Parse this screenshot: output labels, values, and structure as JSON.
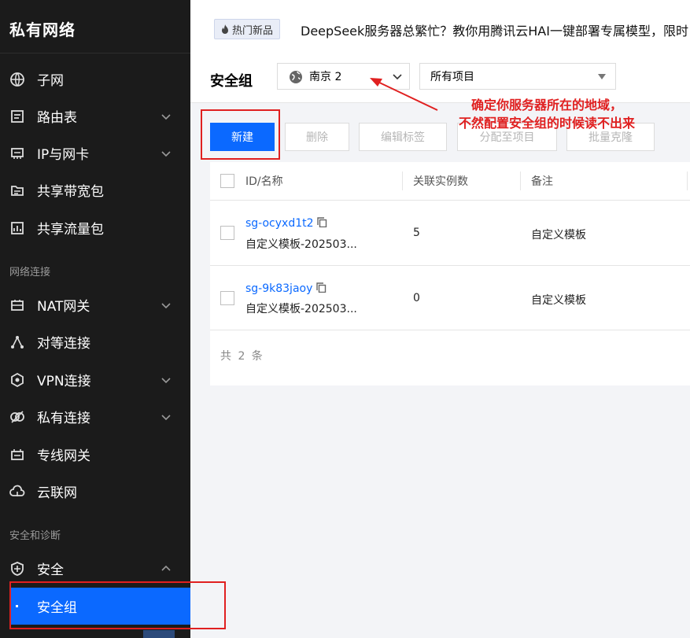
{
  "sidebar": {
    "title": "私有网络",
    "items": [
      {
        "label": "子网",
        "icon": "globe-icon"
      },
      {
        "label": "路由表",
        "icon": "route-table-icon"
      },
      {
        "label": "IP与网卡",
        "icon": "nic-icon"
      },
      {
        "label": "共享带宽包",
        "icon": "bandwidth-icon"
      },
      {
        "label": "共享流量包",
        "icon": "traffic-icon"
      },
      {
        "label": "NAT网关",
        "icon": "nat-icon"
      },
      {
        "label": "对等连接",
        "icon": "peering-icon"
      },
      {
        "label": "VPN连接",
        "icon": "vpn-icon"
      },
      {
        "label": "私有连接",
        "icon": "private-link-icon"
      },
      {
        "label": "专线网关",
        "icon": "dc-gateway-icon"
      },
      {
        "label": "云联网",
        "icon": "ccn-icon"
      },
      {
        "label": "安全",
        "icon": "shield-icon"
      },
      {
        "label": "安全组",
        "icon": "dot-icon"
      }
    ],
    "sections": {
      "network_connect": "网络连接",
      "security_diag": "安全和诊断"
    }
  },
  "banner": {
    "tag": "热门新品",
    "text": "DeepSeek服务器总繁忙？教你用腾讯云HAI一键部署专属模型，限时"
  },
  "page": {
    "title": "安全组",
    "region": "南京 2",
    "project": "所有项目"
  },
  "toolbar": {
    "new": "新建",
    "delete": "删除",
    "edit_tags": "编辑标签",
    "assign_project": "分配至项目",
    "batch_clone": "批量克隆"
  },
  "table": {
    "headers": {
      "id_name": "ID/名称",
      "instances": "关联实例数",
      "remark": "备注"
    },
    "rows": [
      {
        "id": "sg-ocyxd1t2",
        "name": "自定义模板-202503...",
        "instances": "5",
        "remark": "自定义模板"
      },
      {
        "id": "sg-9k83jaoy",
        "name": "自定义模板-202503...",
        "instances": "0",
        "remark": "自定义模板"
      }
    ],
    "total": "共 2 条"
  },
  "annotation": {
    "line1": "确定你服务器所在的地域，",
    "line2": "不然配置安全组的时候读不出来"
  },
  "colors": {
    "accent": "#0b69ff",
    "sidebar_bg": "#1b1b1b",
    "annotation": "#e02020"
  }
}
